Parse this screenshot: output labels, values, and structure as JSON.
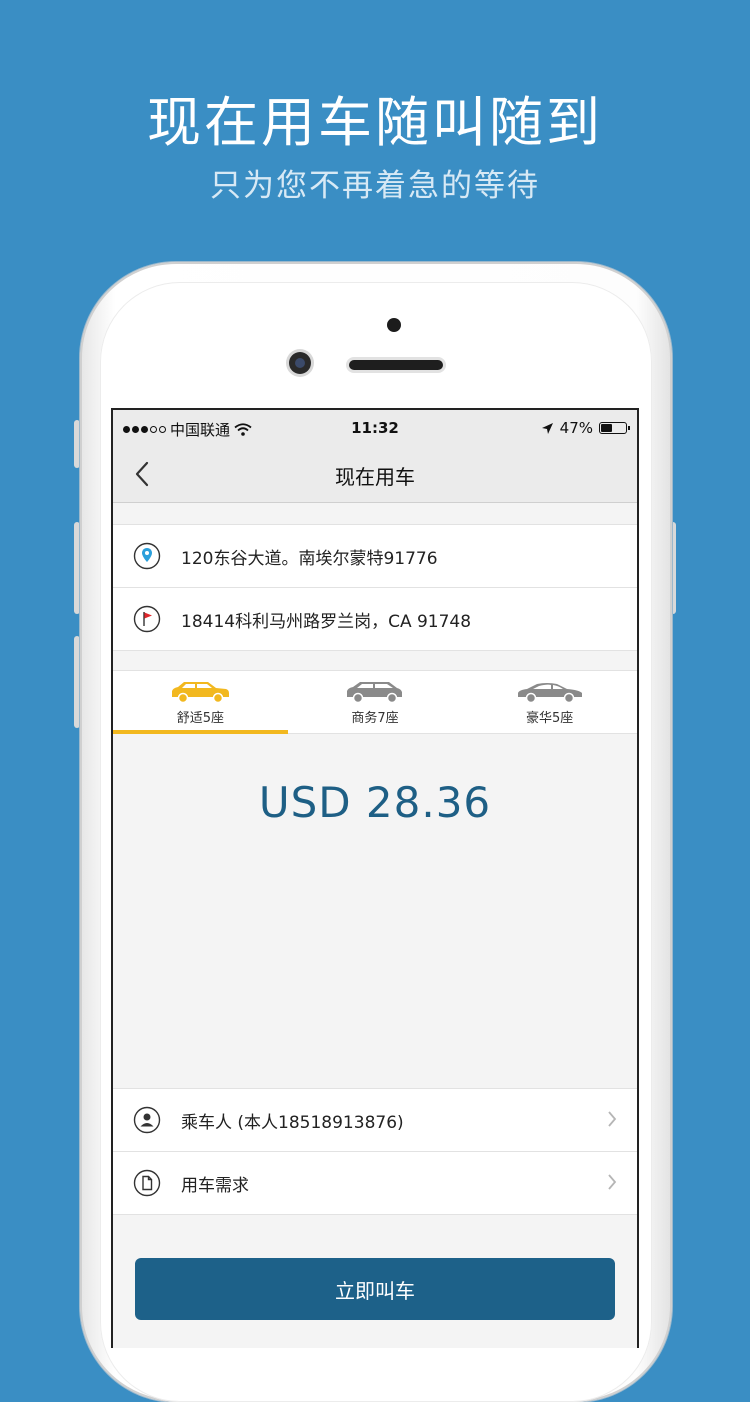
{
  "promo": {
    "headline": "现在用车随叫随到",
    "subline": "只为您不再着急的等待"
  },
  "statusbar": {
    "carrier": "中国联通",
    "time": "11:32",
    "battery": "47%",
    "battery_level": 0.47
  },
  "navbar": {
    "title": "现在用车"
  },
  "addresses": {
    "pickup": "120东谷大道。南埃尔蒙特91776",
    "destination": "18414科利马州路罗兰岗，CA 91748"
  },
  "car_tabs": [
    {
      "label": "舒适5座",
      "selected": true,
      "color": "#f2b81f"
    },
    {
      "label": "商务7座",
      "selected": false,
      "color": "#8a8a8a"
    },
    {
      "label": "豪华5座",
      "selected": false,
      "color": "#8a8a8a"
    }
  ],
  "price": "USD 28.36",
  "info": {
    "passenger": "乘车人 (本人18518913876)",
    "requirements": "用车需求"
  },
  "cta": {
    "label": "立即叫车"
  },
  "colors": {
    "background": "#3a8ec4",
    "accent": "#f2b81f",
    "button": "#1d6189",
    "price": "#1e5f85"
  }
}
